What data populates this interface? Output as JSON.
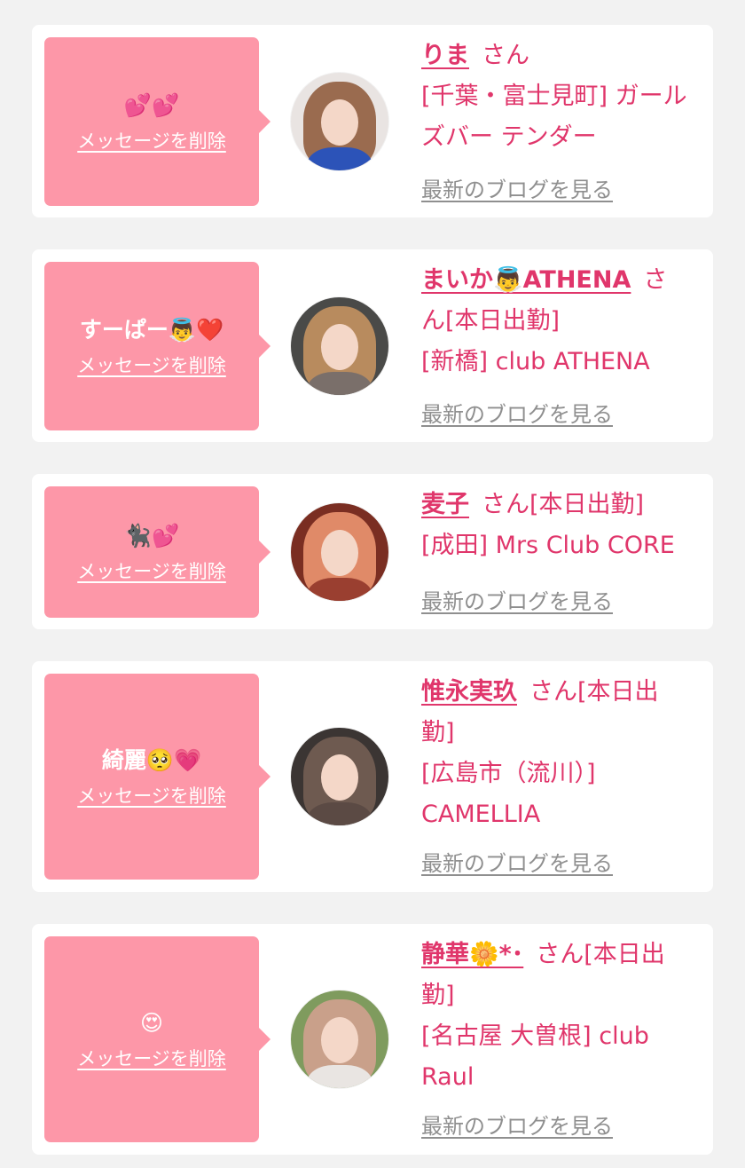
{
  "messages": [
    {
      "bubble_text": "💕💕",
      "delete_label": "メッセージを削除",
      "name": "りま",
      "san": "さん",
      "attendance": "",
      "shop": "[千葉・富士見町] ガールズバー テンダー",
      "blog_label": "最新のブログを見る",
      "avatar_colors": {
        "bg": "#e9e4e2",
        "hair": "#9a6b4f",
        "body": "#2c53b8"
      }
    },
    {
      "bubble_text": "すーぱー👼❤️",
      "delete_label": "メッセージを削除",
      "name": "まいか👼ATHENA",
      "san": "さ",
      "attendance": "ん[本日出勤]",
      "shop": "[新橋] club ATHENA",
      "blog_label": "最新のブログを見る",
      "avatar_colors": {
        "bg": "#4a4a48",
        "hair": "#b88b5e",
        "body": "#7a6f6a"
      }
    },
    {
      "bubble_text": "🐈‍⬛💕",
      "delete_label": "メッセージを削除",
      "name": "麦子",
      "san": "さん",
      "attendance": "[本日出勤]",
      "shop": "[成田] Mrs Club CORE",
      "blog_label": "最新のブログを見る",
      "avatar_colors": {
        "bg": "#7a2e22",
        "hair": "#e08a68",
        "body": "#9a3f30"
      }
    },
    {
      "bubble_text": "綺麗🥺💗",
      "delete_label": "メッセージを削除",
      "name": "惟永実玖",
      "san": "さん",
      "attendance": "[本日出勤]",
      "shop": "[広島市（流川）] CAMELLIA",
      "blog_label": "最新のブログを見る",
      "avatar_colors": {
        "bg": "#3b3533",
        "hair": "#6e5a50",
        "body": "#5b4a44"
      }
    },
    {
      "bubble_text": "😍",
      "delete_label": "メッセージを削除",
      "name": "静華🌼*･",
      "san": "さん",
      "attendance": "[本日出勤]",
      "shop": "[名古屋 大曽根] club Raul",
      "blog_label": "最新のブログを見る",
      "avatar_colors": {
        "bg": "#7f9b5e",
        "hair": "#c9a08a",
        "body": "#e9e5e2"
      }
    }
  ]
}
